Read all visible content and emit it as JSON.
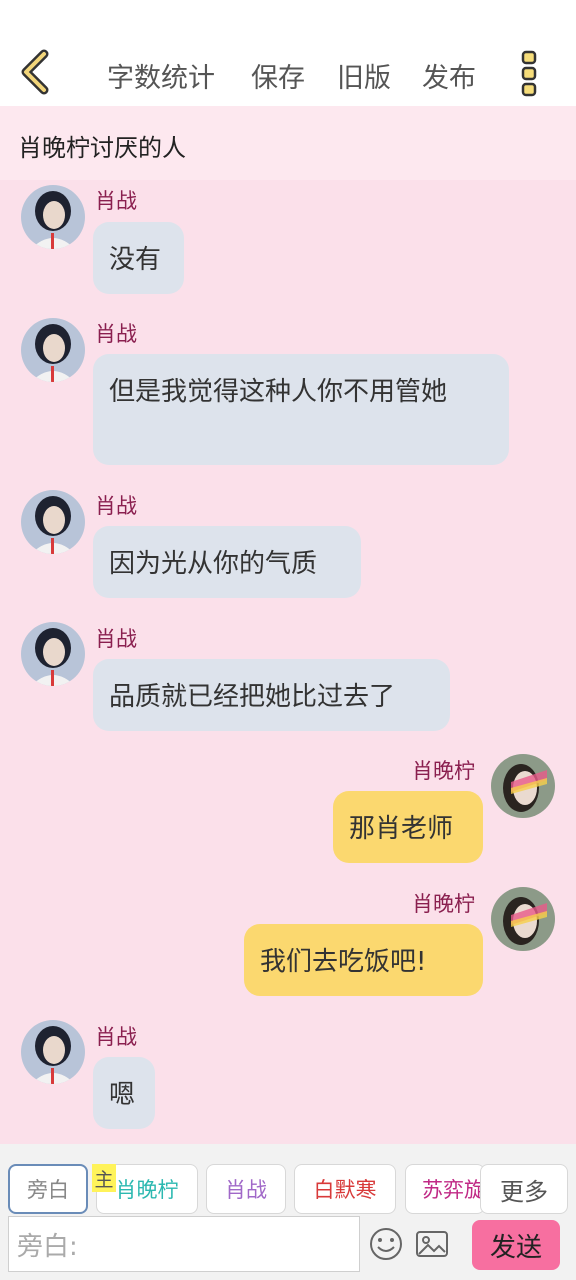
{
  "toolbar": {
    "menu": [
      "字数统计",
      "保存",
      "旧版",
      "发布"
    ]
  },
  "chat": {
    "title": "肖晚柠讨厌的人"
  },
  "messages": [
    {
      "sender": "肖战",
      "text": "没有",
      "side": "left"
    },
    {
      "sender": "肖战",
      "text": "但是我觉得这种人你不用管她",
      "side": "left"
    },
    {
      "sender": "肖战",
      "text": "因为光从你的气质",
      "side": "left"
    },
    {
      "sender": "肖战",
      "text": "品质就已经把她比过去了",
      "side": "left"
    },
    {
      "sender": "肖晚柠",
      "text": "那肖老师",
      "side": "right"
    },
    {
      "sender": "肖晚柠",
      "text": "我们去吃饭吧!",
      "side": "right"
    },
    {
      "sender": "肖战",
      "text": "嗯",
      "side": "left"
    }
  ],
  "roles": {
    "chips": [
      "旁白",
      "肖晚柠",
      "肖战",
      "白默寒",
      "苏弈旋"
    ],
    "main_tag": "主",
    "more_label": "更多"
  },
  "composer": {
    "placeholder": "旁白:",
    "send_label": "发送"
  },
  "colors": {
    "accent_pink": "#f76fa0",
    "bubble_left": "#dde3ec",
    "bubble_right": "#fbd86f",
    "background": "#fbe0ea",
    "sender_name": "#8a1f4f",
    "chip_teal": "#2bb8b0",
    "chip_purple": "#a068c8",
    "chip_red": "#d83a3a",
    "chip_magenta": "#c02a86"
  }
}
